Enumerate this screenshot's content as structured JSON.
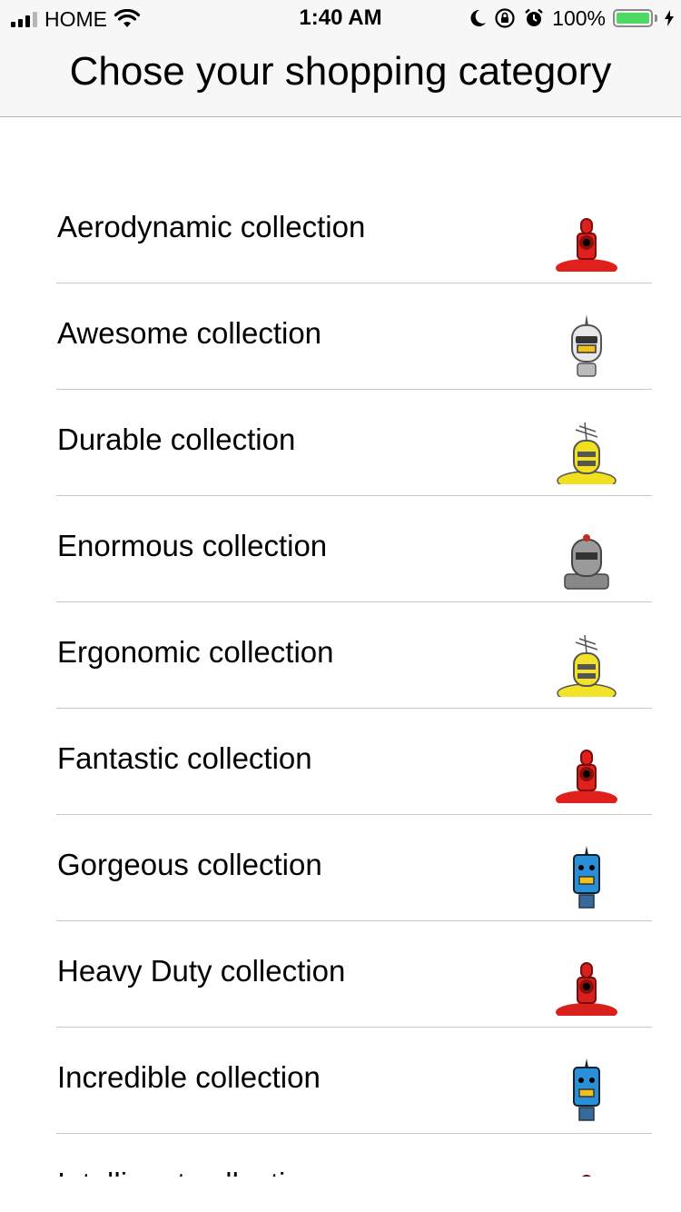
{
  "status_bar": {
    "carrier": "HOME",
    "time": "1:40 AM",
    "battery_percent": "100%",
    "battery_level": 1.0,
    "battery_color": "#4cd964"
  },
  "nav": {
    "title": "Chose your shopping category"
  },
  "categories": [
    {
      "label": "Aerodynamic collection",
      "icon": "red-robot-icon",
      "color": "#e0201c"
    },
    {
      "label": "Awesome collection",
      "icon": "white-robot-icon",
      "color": "#e8e8e8"
    },
    {
      "label": "Durable collection",
      "icon": "yellow-robot-icon",
      "color": "#f0e020"
    },
    {
      "label": "Enormous collection",
      "icon": "gray-robot-icon",
      "color": "#9a9a9a"
    },
    {
      "label": "Ergonomic collection",
      "icon": "yellow-robot-icon",
      "color": "#f2e22a"
    },
    {
      "label": "Fantastic collection",
      "icon": "red-robot-icon",
      "color": "#e0201c"
    },
    {
      "label": "Gorgeous collection",
      "icon": "blue-robot-icon",
      "color": "#2a8fd6"
    },
    {
      "label": "Heavy Duty collection",
      "icon": "red-robot-icon",
      "color": "#d8201c"
    },
    {
      "label": "Incredible collection",
      "icon": "blue-robot-icon",
      "color": "#2a8fd6"
    },
    {
      "label": "Intelligent collection",
      "icon": "red-robot-icon",
      "color": "#e0201c"
    }
  ]
}
